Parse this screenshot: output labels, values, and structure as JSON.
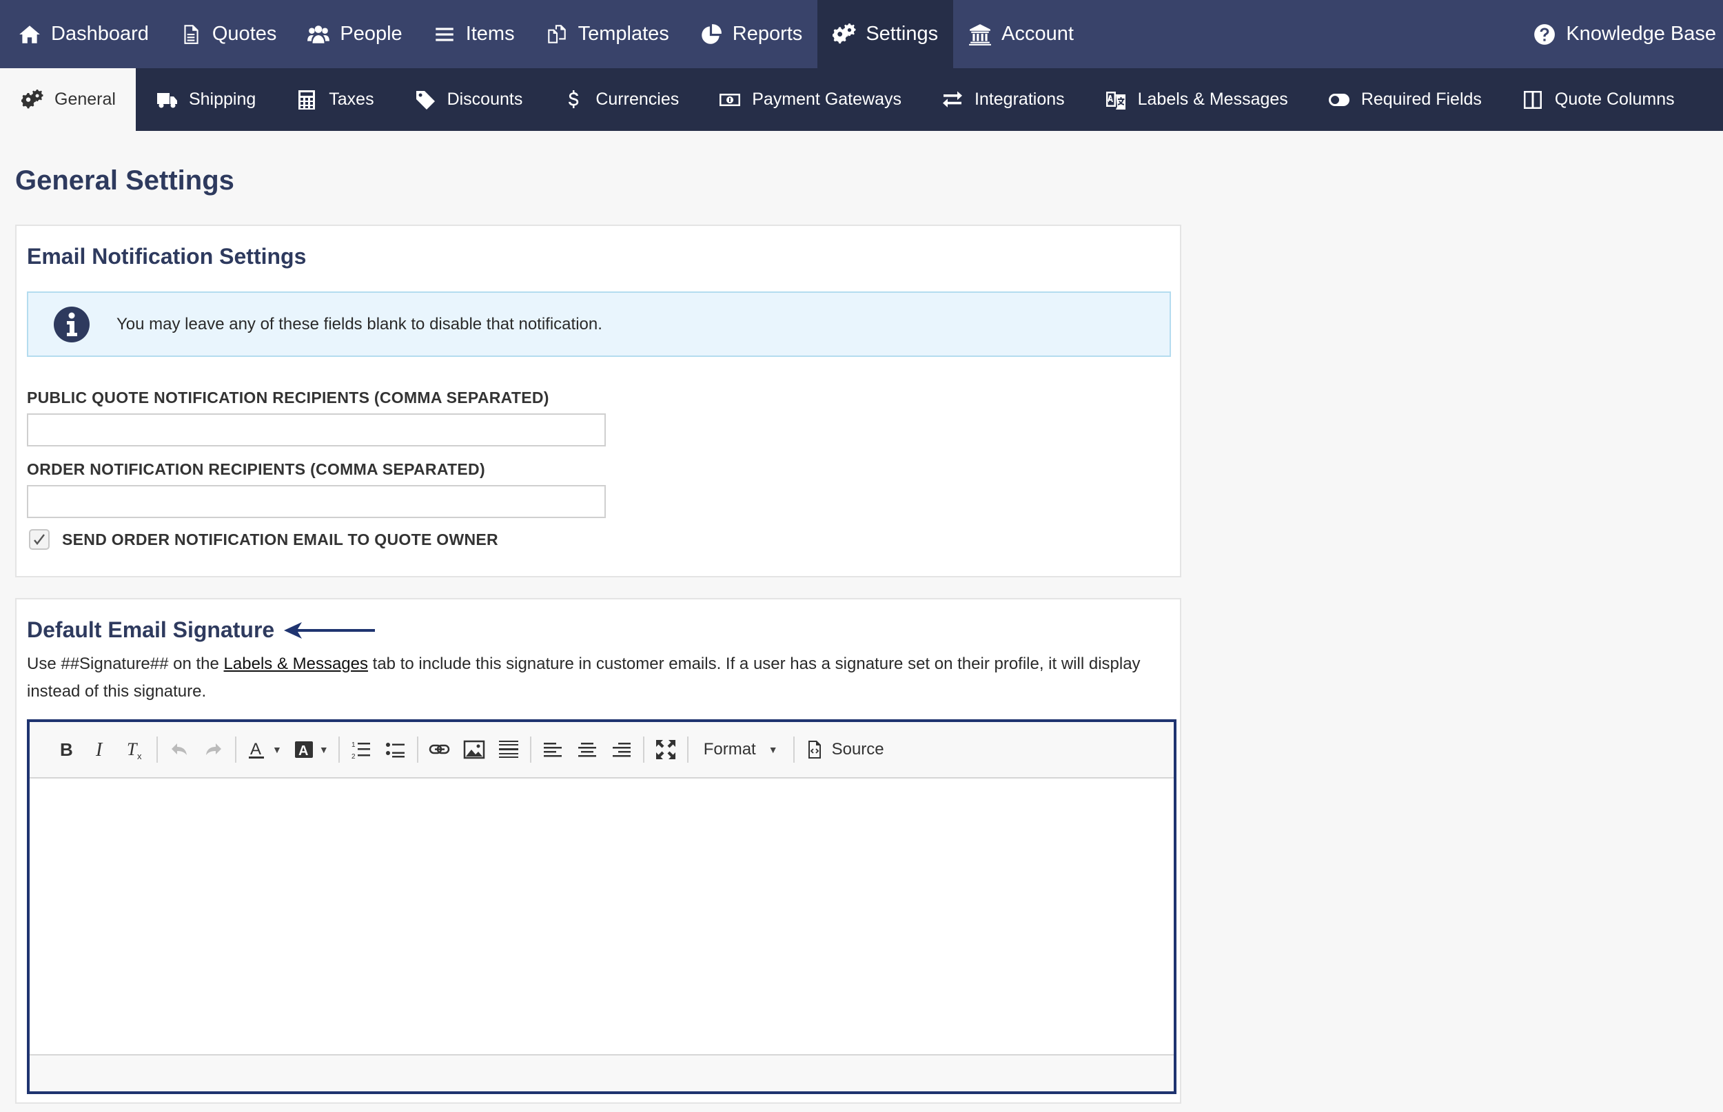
{
  "top_nav": {
    "items": [
      {
        "label": "Dashboard",
        "icon": "home-icon"
      },
      {
        "label": "Quotes",
        "icon": "document-icon"
      },
      {
        "label": "People",
        "icon": "people-icon"
      },
      {
        "label": "Items",
        "icon": "list-icon"
      },
      {
        "label": "Templates",
        "icon": "copy-icon"
      },
      {
        "label": "Reports",
        "icon": "pie-chart-icon"
      },
      {
        "label": "Settings",
        "icon": "gears-icon",
        "active": true
      },
      {
        "label": "Account",
        "icon": "bank-icon"
      }
    ],
    "knowledge_base": {
      "label": "Knowledge Base",
      "icon": "question-circle-icon"
    }
  },
  "sub_nav": {
    "items": [
      {
        "label": "General",
        "icon": "gears-icon",
        "active": true
      },
      {
        "label": "Shipping",
        "icon": "truck-icon"
      },
      {
        "label": "Taxes",
        "icon": "calculator-icon"
      },
      {
        "label": "Discounts",
        "icon": "tag-icon"
      },
      {
        "label": "Currencies",
        "icon": "dollar-icon"
      },
      {
        "label": "Payment Gateways",
        "icon": "money-icon"
      },
      {
        "label": "Integrations",
        "icon": "exchange-icon"
      },
      {
        "label": "Labels & Messages",
        "icon": "language-icon"
      },
      {
        "label": "Required Fields",
        "icon": "toggle-icon"
      },
      {
        "label": "Quote Columns",
        "icon": "columns-icon"
      }
    ]
  },
  "page": {
    "title": "General Settings"
  },
  "email_notifications": {
    "heading": "Email Notification Settings",
    "info_text": "You may leave any of these fields blank to disable that notification.",
    "public_quote_label": "PUBLIC QUOTE NOTIFICATION RECIPIENTS (COMMA SEPARATED)",
    "public_quote_value": "",
    "order_label": "ORDER NOTIFICATION RECIPIENTS (COMMA SEPARATED)",
    "order_value": "",
    "send_owner_label": "SEND ORDER NOTIFICATION EMAIL TO QUOTE OWNER",
    "send_owner_checked": true
  },
  "signature": {
    "heading": "Default Email Signature",
    "desc_before": "Use ##Signature## on the ",
    "desc_link": "Labels & Messages",
    "desc_after": " tab to include this signature in customer emails. If a user has a signature set on their profile, it will display instead of this signature.",
    "accent_color": "#1f3470"
  },
  "editor": {
    "format_label": "Format",
    "source_label": "Source"
  },
  "colors": {
    "nav_bg": "#39436a",
    "nav_active_bg": "#262e48",
    "heading": "#2e3a5e"
  }
}
